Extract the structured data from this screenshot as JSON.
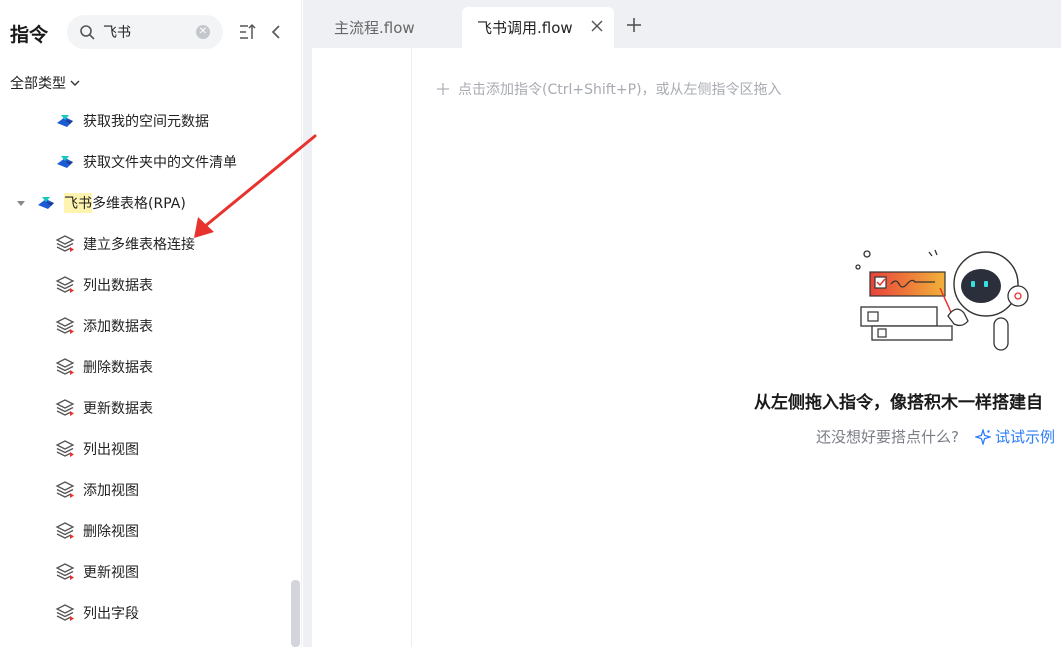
{
  "sidebar": {
    "title": "指令",
    "search": {
      "value": "飞书",
      "placeholder": ""
    },
    "type_filter": "全部类型",
    "items": [
      {
        "label": "获取我的空间元数据",
        "kind": "sub",
        "icon": "feishu-logo-icon"
      },
      {
        "label": "获取文件夹中的文件清单",
        "kind": "sub",
        "icon": "feishu-logo-icon"
      },
      {
        "label_highlight": "飞书",
        "label_rest": "多维表格(RPA)",
        "kind": "group",
        "icon": "feishu-logo-icon"
      },
      {
        "label": "建立多维表格连接",
        "kind": "sub",
        "icon": "layers-icon"
      },
      {
        "label": "列出数据表",
        "kind": "sub",
        "icon": "layers-icon"
      },
      {
        "label": "添加数据表",
        "kind": "sub",
        "icon": "layers-icon"
      },
      {
        "label": "删除数据表",
        "kind": "sub",
        "icon": "layers-icon"
      },
      {
        "label": "更新数据表",
        "kind": "sub",
        "icon": "layers-icon"
      },
      {
        "label": "列出视图",
        "kind": "sub",
        "icon": "layers-icon"
      },
      {
        "label": "添加视图",
        "kind": "sub",
        "icon": "layers-icon"
      },
      {
        "label": "删除视图",
        "kind": "sub",
        "icon": "layers-icon"
      },
      {
        "label": "更新视图",
        "kind": "sub",
        "icon": "layers-icon"
      },
      {
        "label": "列出字段",
        "kind": "sub",
        "icon": "layers-icon"
      }
    ]
  },
  "tabs": [
    {
      "label": "主流程.flow",
      "active": false
    },
    {
      "label": "飞书调用.flow",
      "active": true
    }
  ],
  "editor": {
    "add_hint": "点击添加指令(Ctrl+Shift+P)，或从左侧指令区拖入",
    "empty_title": "从左侧拖入指令，像搭积木一样搭建自",
    "empty_sub": "还没想好要搭点什么?",
    "try_link": "试试示例"
  },
  "colors": {
    "accent": "#2c7ef8",
    "highlight": "#fff3b0",
    "annotation_arrow": "#e8322e"
  }
}
